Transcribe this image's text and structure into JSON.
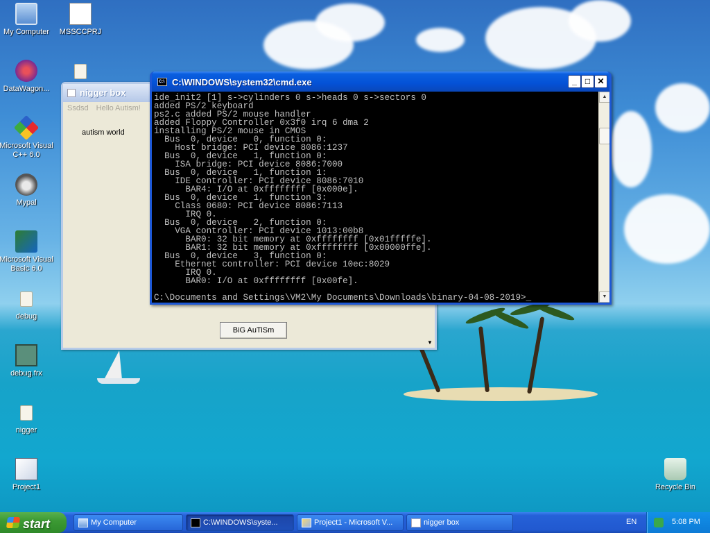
{
  "desktop": {
    "icons": [
      {
        "label": "My Computer",
        "icon": "my-computer-icon"
      },
      {
        "label": "MSSCCPRJ",
        "icon": "document-icon"
      },
      {
        "label": "DataWagon...",
        "icon": "shortcut-icon"
      },
      {
        "label": "Microsoft Visual C++ 6.0",
        "icon": "visual-cpp-icon"
      },
      {
        "label": "Mypal",
        "icon": "mypal-icon"
      },
      {
        "label": "Microsoft Visual Basic 6.0",
        "icon": "visual-basic-icon"
      },
      {
        "label": "debug",
        "icon": "folder-icon"
      },
      {
        "label": "debug.frx",
        "icon": "frx-file-icon"
      },
      {
        "label": "nigger",
        "icon": "folder-icon"
      },
      {
        "label": "Project1",
        "icon": "project-icon"
      },
      {
        "label": "Recycle Bin",
        "icon": "recycle-bin-icon"
      }
    ]
  },
  "vb_window": {
    "title": "nigger box",
    "menu": [
      "Ssdsd",
      "Hello Autism!"
    ],
    "label": "autism world",
    "button": "BiG AuTiSm"
  },
  "cmd_window": {
    "title": "C:\\WINDOWS\\system32\\cmd.exe",
    "lines": [
      "ide_init2 [1] s->cylinders 0 s->heads 0 s->sectors 0",
      "added PS/2 keyboard",
      "ps2.c added PS/2 mouse handler",
      "added Floppy Controller 0x3f0 irq 6 dma 2",
      "installing PS/2 mouse in CMOS",
      "  Bus  0, device   0, function 0:",
      "    Host bridge: PCI device 8086:1237",
      "  Bus  0, device   1, function 0:",
      "    ISA bridge: PCI device 8086:7000",
      "  Bus  0, device   1, function 1:",
      "    IDE controller: PCI device 8086:7010",
      "      BAR4: I/O at 0xffffffff [0x000e].",
      "  Bus  0, device   1, function 3:",
      "    Class 0680: PCI device 8086:7113",
      "      IRQ 0.",
      "  Bus  0, device   2, function 0:",
      "    VGA controller: PCI device 1013:00b8",
      "      BAR0: 32 bit memory at 0xffffffff [0x01fffffe].",
      "      BAR1: 32 bit memory at 0xffffffff [0x00000ffe].",
      "  Bus  0, device   3, function 0:",
      "    Ethernet controller: PCI device 10ec:8029",
      "      IRQ 0.",
      "      BAR0: I/O at 0xffffffff [0x00fe].",
      "",
      "C:\\Documents and Settings\\VM2\\My Documents\\Downloads\\binary-04-08-2019>_"
    ]
  },
  "taskbar": {
    "start_label": "start",
    "tasks": [
      {
        "label": "My Computer",
        "icon": "my-computer-icon",
        "active": false
      },
      {
        "label": "C:\\WINDOWS\\syste...",
        "icon": "cmd-icon",
        "active": true
      },
      {
        "label": "Project1 - Microsoft V...",
        "icon": "visual-basic-icon",
        "active": false
      },
      {
        "label": "nigger box",
        "icon": "form-icon",
        "active": false
      }
    ],
    "language": "EN",
    "clock": "5:08 PM"
  }
}
